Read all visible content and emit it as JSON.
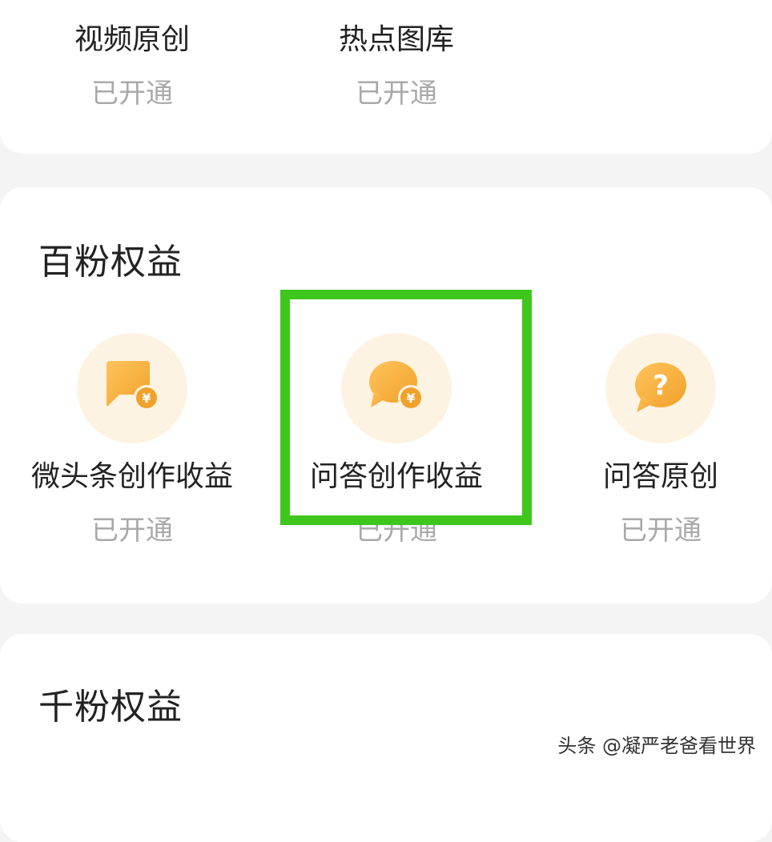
{
  "top_section": {
    "items": [
      {
        "label": "视频原创",
        "status": "已开通"
      },
      {
        "label": "热点图库",
        "status": "已开通"
      }
    ]
  },
  "hundred_fans": {
    "title": "百粉权益",
    "items": [
      {
        "label": "微头条创作收益",
        "status": "已开通",
        "icon": "yuan-flag-icon"
      },
      {
        "label": "问答创作收益",
        "status": "已开通",
        "icon": "yuan-bubble-icon"
      },
      {
        "label": "问答原创",
        "status": "已开通",
        "icon": "question-bubble-icon"
      }
    ],
    "highlighted_item": "问答创作收益"
  },
  "thousand_fans": {
    "title": "千粉权益"
  },
  "watermark": "头条 @凝严老爸看世界",
  "colors": {
    "highlight": "#3ec61c",
    "icon_gradient_start": "#ffc45c",
    "icon_gradient_end": "#f0a12b",
    "icon_background": "#fdf3e3",
    "status_text": "#a9a9a9"
  }
}
